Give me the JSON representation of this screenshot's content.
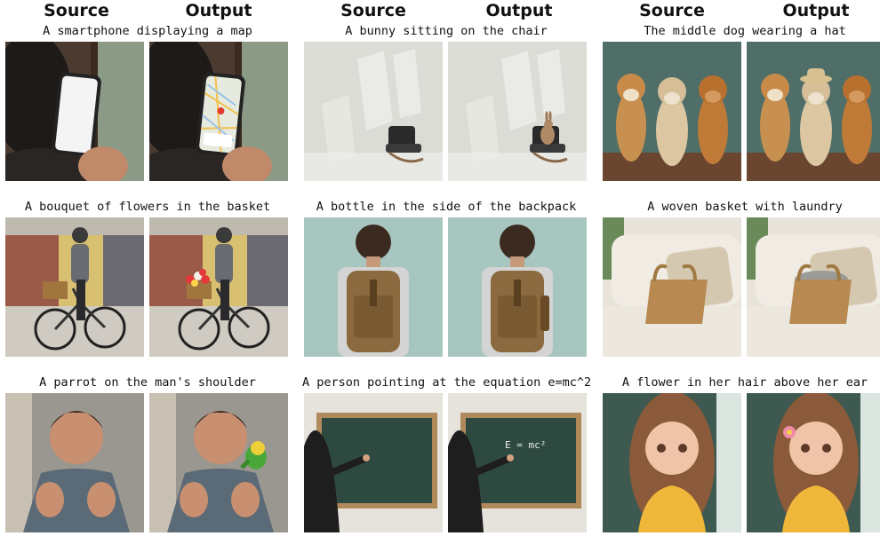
{
  "headers": [
    "Source",
    "Output",
    "Source",
    "Output",
    "Source",
    "Output"
  ],
  "captions": [
    "A smartphone displaying a map",
    "A bunny sitting on the chair",
    "The middle dog wearing a hat",
    "A bouquet of flowers in the basket",
    "A bottle in the side of the backpack",
    "A woven basket with laundry",
    "A parrot on the man's shoulder",
    "A person pointing at the equation e=mc^2",
    "A flower in her hair above her ear"
  ],
  "chalkboard_text": "E = mc²"
}
